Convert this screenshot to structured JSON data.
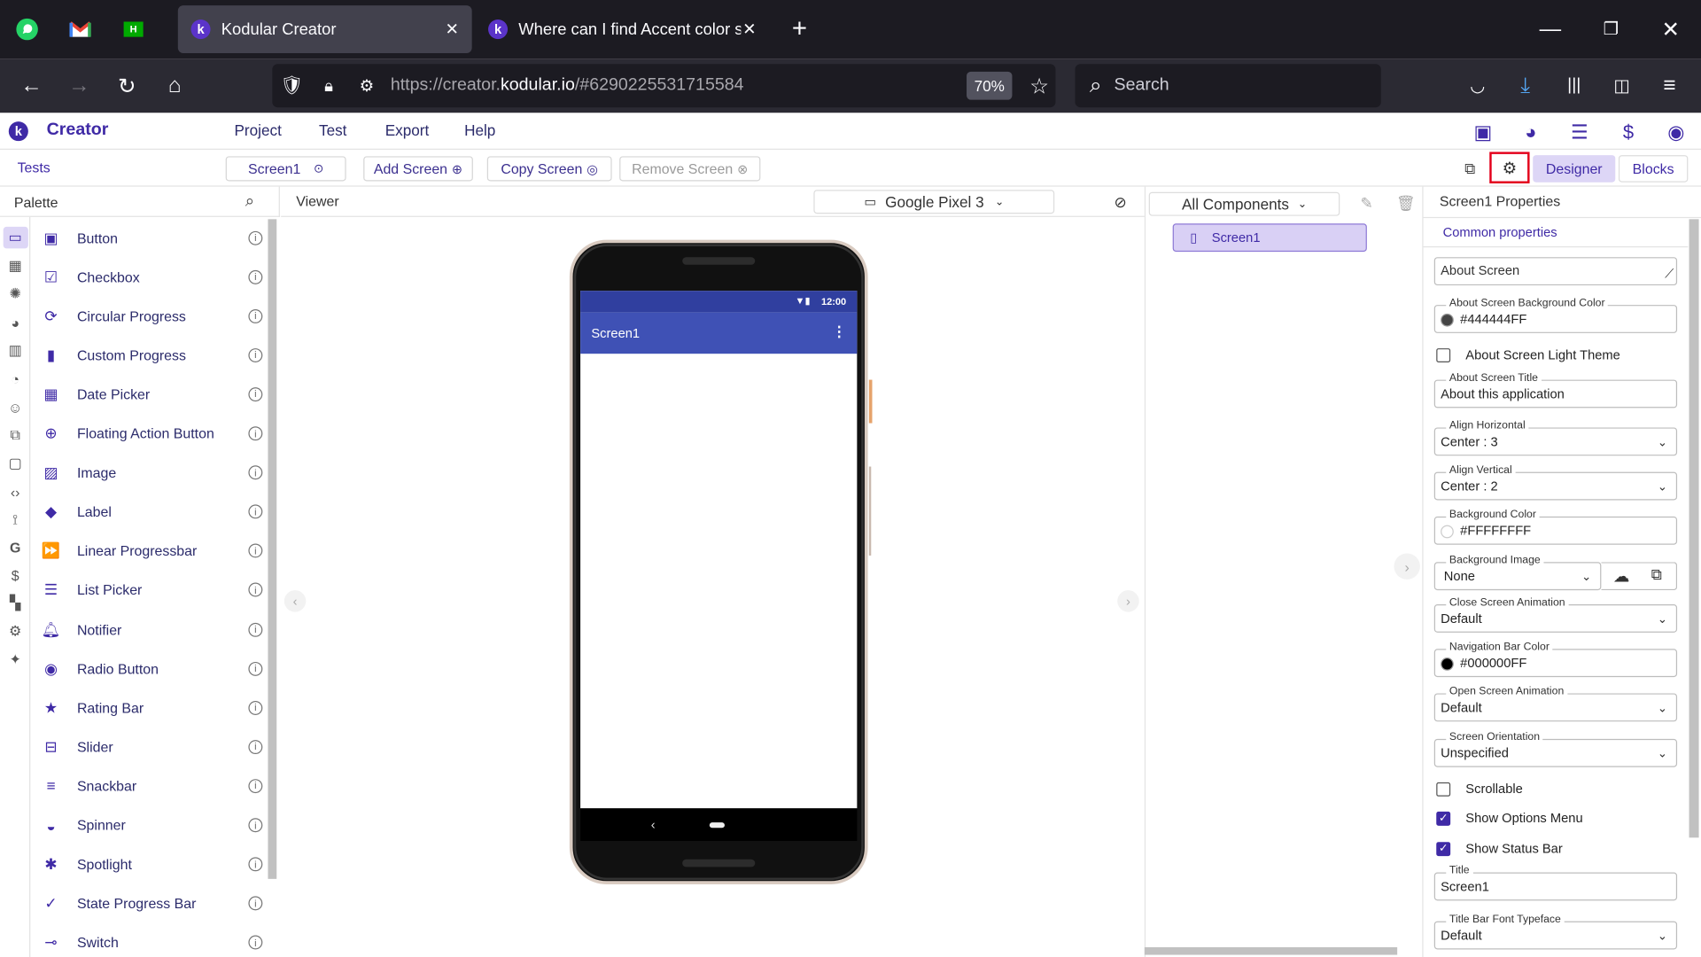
{
  "browser": {
    "tabs": [
      {
        "label": "Kodular Creator"
      },
      {
        "label": "Where can I find Accent color sc"
      }
    ],
    "url_prefix": "https://creator.",
    "url_domain": "kodular.io",
    "url_suffix": "/#6290225531715584",
    "zoom": "70%",
    "search_placeholder": "Search"
  },
  "app": {
    "brand": "Creator",
    "menu": [
      "Project",
      "Test",
      "Export",
      "Help"
    ],
    "project_name": "Tests",
    "screen_select": "Screen1",
    "add_screen": "Add Screen",
    "copy_screen": "Copy Screen",
    "remove_screen": "Remove Screen",
    "designer_tab": "Designer",
    "blocks_tab": "Blocks"
  },
  "palette": {
    "title": "Palette",
    "items": [
      {
        "label": "Button",
        "icon": "button-icon"
      },
      {
        "label": "Checkbox",
        "icon": "checkbox-icon"
      },
      {
        "label": "Circular Progress",
        "icon": "circular-progress-icon"
      },
      {
        "label": "Custom Progress",
        "icon": "custom-progress-icon"
      },
      {
        "label": "Date Picker",
        "icon": "date-picker-icon"
      },
      {
        "label": "Floating Action Button",
        "icon": "fab-icon"
      },
      {
        "label": "Image",
        "icon": "image-icon"
      },
      {
        "label": "Label",
        "icon": "label-icon"
      },
      {
        "label": "Linear Progressbar",
        "icon": "linear-progress-icon"
      },
      {
        "label": "List Picker",
        "icon": "list-picker-icon"
      },
      {
        "label": "Notifier",
        "icon": "bell-icon"
      },
      {
        "label": "Radio Button",
        "icon": "radio-icon"
      },
      {
        "label": "Rating Bar",
        "icon": "star-icon"
      },
      {
        "label": "Slider",
        "icon": "slider-icon"
      },
      {
        "label": "Snackbar",
        "icon": "snackbar-icon"
      },
      {
        "label": "Spinner",
        "icon": "spinner-icon"
      },
      {
        "label": "Spotlight",
        "icon": "spotlight-icon"
      },
      {
        "label": "State Progress Bar",
        "icon": "state-progress-icon"
      },
      {
        "label": "Switch",
        "icon": "switch-icon"
      }
    ]
  },
  "viewer": {
    "title": "Viewer",
    "device": "Google Pixel 3",
    "status_time": "12:00",
    "screen_title": "Screen1"
  },
  "components": {
    "filter": "All Components",
    "tree": [
      {
        "label": "Screen1"
      }
    ]
  },
  "properties": {
    "title": "Screen1 Properties",
    "section": "Common properties",
    "about_screen_placeholder": "About Screen",
    "fields": {
      "about_bg_color": {
        "label": "About Screen Background Color",
        "value": "#444444FF",
        "color": "#444444"
      },
      "about_title": {
        "label": "About Screen Title",
        "value": "About this application"
      },
      "align_h": {
        "label": "Align Horizontal",
        "value": "Center : 3"
      },
      "align_v": {
        "label": "Align Vertical",
        "value": "Center : 2"
      },
      "bg_color": {
        "label": "Background Color",
        "value": "#FFFFFFFF",
        "color": "#ffffff"
      },
      "bg_image": {
        "label": "Background Image",
        "value": "None"
      },
      "close_anim": {
        "label": "Close Screen Animation",
        "value": "Default"
      },
      "nav_color": {
        "label": "Navigation Bar Color",
        "value": "#000000FF",
        "color": "#000000"
      },
      "open_anim": {
        "label": "Open Screen Animation",
        "value": "Default"
      },
      "orientation": {
        "label": "Screen Orientation",
        "value": "Unspecified"
      },
      "title": {
        "label": "Title",
        "value": "Screen1"
      },
      "title_font": {
        "label": "Title Bar Font Typeface",
        "value": "Default"
      }
    },
    "checkboxes": {
      "light_theme": {
        "label": "About Screen Light Theme",
        "checked": false
      },
      "scrollable": {
        "label": "Scrollable",
        "checked": false
      },
      "options_menu": {
        "label": "Show Options Menu",
        "checked": true
      },
      "status_bar": {
        "label": "Show Status Bar",
        "checked": true
      }
    }
  },
  "colors": {
    "accent": "#3f2aa6",
    "appbar": "#3f51b5",
    "selected": "#d9d0f5"
  }
}
